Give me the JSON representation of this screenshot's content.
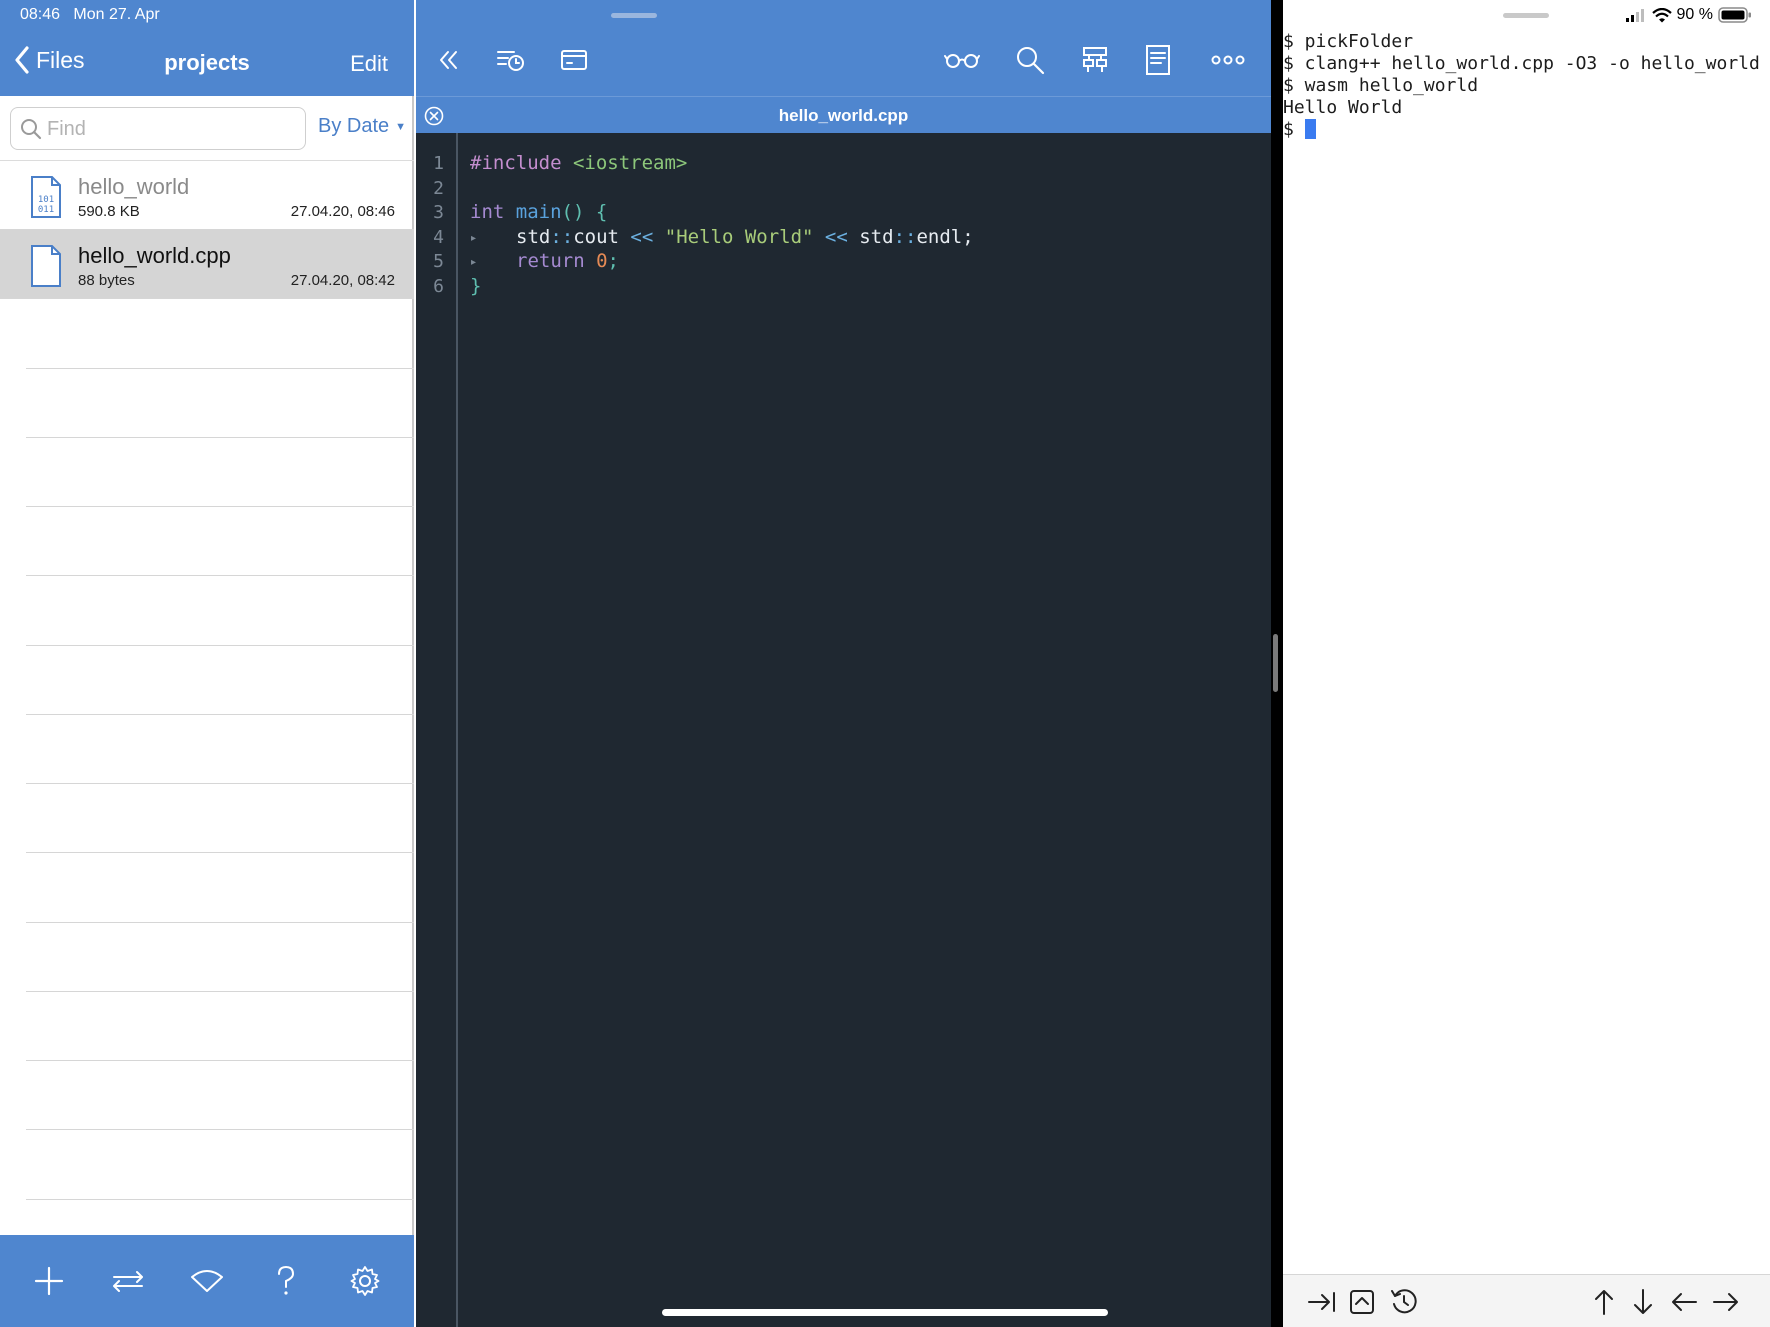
{
  "status_bar": {
    "time": "08:46",
    "date": "Mon 27. Apr",
    "battery": "90 %"
  },
  "files": {
    "back_label": "Files",
    "title": "projects",
    "edit_label": "Edit",
    "search_placeholder": "Find",
    "sort_label": "By Date",
    "items": [
      {
        "name": "hello_world",
        "size": "590.8 KB",
        "date": "27.04.20, 08:46",
        "icon": "binary-file-icon"
      },
      {
        "name": "hello_world.cpp",
        "size": "88 bytes",
        "date": "27.04.20, 08:42",
        "icon": "document-icon"
      }
    ],
    "toolbar_icons": [
      "plus-icon",
      "transfer-arrows-icon",
      "wifi-icon",
      "help-icon",
      "gear-icon"
    ]
  },
  "editor": {
    "tab_title": "hello_world.cpp",
    "toolbar_icons": [
      "double-chevron-left-icon",
      "history-icon",
      "terminal-icon",
      "glasses-icon",
      "search-icon",
      "layout-icon",
      "document-icon",
      "more-icon"
    ],
    "line_numbers": [
      "1",
      "2",
      "3",
      "4",
      "5",
      "6"
    ],
    "code": {
      "l1_pp": "#include",
      "l1_inc": " <iostream>",
      "l3_kw": "int",
      "l3_fn": " main",
      "l3_punc": "() {",
      "l4_a": "std",
      "l4_b": "::",
      "l4_c": "cout",
      "l4_d": " << ",
      "l4_e": "\"Hello World\"",
      "l4_f": " << ",
      "l4_g": "std",
      "l4_h": "::",
      "l4_i": "endl;",
      "l5_kw": "return",
      "l5_num": " 0",
      "l5_punc": ";",
      "l6_punc": "}"
    },
    "colors": {
      "background": "#1f2831",
      "preprocessor": "#c48ecf",
      "include": "#8cc67a",
      "keyword": "#a58ad1",
      "function": "#5aa2dd",
      "string": "#a8cc7a",
      "number": "#e58a55"
    }
  },
  "terminal": {
    "lines": [
      "$ pickFolder",
      "$ clang++ hello_world.cpp -O3 -o hello_world",
      "$ wasm hello_world",
      "Hello World"
    ],
    "prompt": "$ ",
    "toolbar_icons": [
      "tab-icon",
      "control-icon",
      "history-icon",
      "arrow-up-icon",
      "arrow-down-icon",
      "arrow-left-icon",
      "arrow-right-icon"
    ]
  },
  "accent_color": "#4f86cf"
}
